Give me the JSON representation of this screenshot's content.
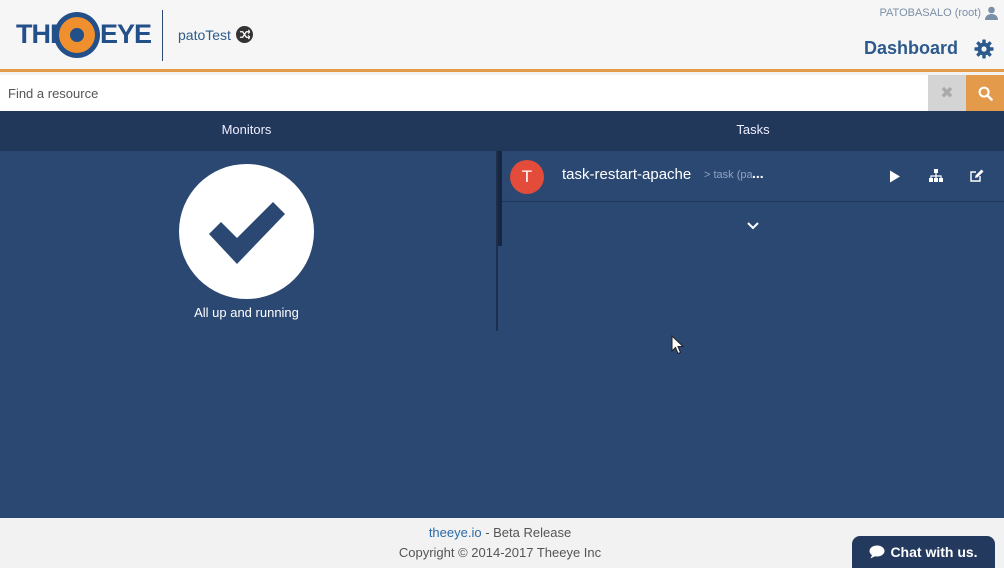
{
  "header": {
    "logo": {
      "left": "THE",
      "right": "EYE"
    },
    "org_name": "patoTest",
    "user_label": "PATOBASALO (root)",
    "dashboard_label": "Dashboard"
  },
  "search": {
    "placeholder": "Find a resource",
    "value": "",
    "clear_glyph": "✖"
  },
  "tabs": [
    {
      "label": "Monitors"
    },
    {
      "label": "Tasks"
    }
  ],
  "monitors": {
    "status_text": "All up and running"
  },
  "tasks": [
    {
      "avatar": "T",
      "name": "task-restart-apache",
      "type_label": "> task (pa",
      "ellipsis": "..."
    }
  ],
  "footer": {
    "link_text": "theeye.io",
    "release_text": " - Beta Release",
    "copyright": "Copyright © 2014-2017 Theeye Inc"
  },
  "chat": {
    "label": "Chat with us."
  },
  "colors": {
    "brand_blue": "#24508a",
    "brand_orange": "#ef8f2d",
    "panel_bg": "#2b4873",
    "tabs_bg": "#21385b",
    "avatar_red": "#e34b3b"
  },
  "icons": [
    "shuffle-icon",
    "user-icon",
    "gear-icon",
    "clear-icon",
    "search-icon",
    "checkmark-icon",
    "play-icon",
    "workflow-icon",
    "edit-icon",
    "chevron-down-icon",
    "chat-icon",
    "cursor-icon"
  ]
}
